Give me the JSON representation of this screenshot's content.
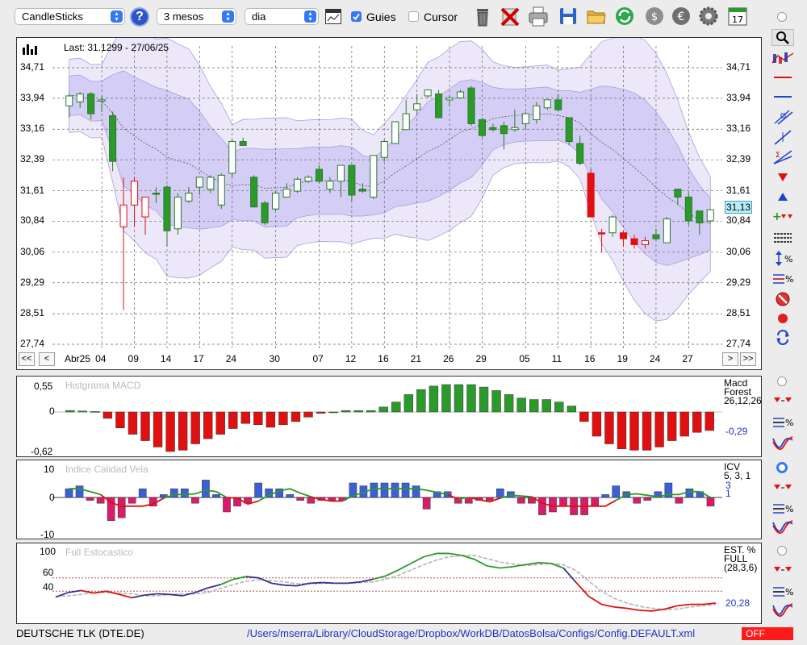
{
  "toolbar": {
    "chart_type": "CandleSticks",
    "period": "3 mesos",
    "interval": "dia",
    "guides_label": "Guies",
    "guides_checked": true,
    "cursor_label": "Cursor",
    "cursor_checked": false,
    "help": "?",
    "calendar_day": "17"
  },
  "main": {
    "last_label": "Last: 31.1299 - 27/06/25",
    "y_ticks": [
      "34,71",
      "33,94",
      "33,16",
      "32,39",
      "31,61",
      "30,84",
      "30,06",
      "29,29",
      "28,51",
      "27,74"
    ],
    "current_value": "31,13",
    "x_month": "Abr25",
    "x_ticks": [
      "04",
      "09",
      "14",
      "17",
      "24",
      "30",
      "07",
      "12",
      "16",
      "21",
      "26",
      "29",
      "05",
      "11",
      "16",
      "19",
      "24",
      "27"
    ],
    "nav": {
      "first": "<<",
      "prev": "<",
      "next": ">",
      "last": ">>"
    }
  },
  "macd": {
    "title": "Histgrama MACD",
    "y_ticks": [
      "0,55",
      "0",
      "-0,62"
    ],
    "name1": "Macd",
    "name2": "Forest",
    "params": "26,12,26",
    "value": "-0,29"
  },
  "icv": {
    "title": "Indice Calidad Vela",
    "y_ticks": [
      "10",
      "0",
      "-10"
    ],
    "name": "ICV",
    "params": "5, 3, 1",
    "value1": "3",
    "value2": "1"
  },
  "stoch": {
    "title": "Full Estocastico",
    "y_ticks": [
      "100",
      "60",
      "40",
      "0"
    ],
    "name1": "EST. %",
    "name2": "FULL",
    "params": "(28,3,6)",
    "value": "20,28"
  },
  "status": {
    "ticker": "DEUTSCHE TLK (DTE.DE)",
    "path": "/Users/mserra/Library/CloudStorage/Dropbox/WorkDB/DatosBolsa/Configs/Config.DEFAULT.xml",
    "state": "OFF"
  },
  "chart_data": {
    "type": "candlestick",
    "price_range": [
      27.74,
      34.71
    ],
    "up_color": "#ffffff",
    "down_color": "#2b9a2b",
    "falling_color": "#e01010",
    "candles": [
      {
        "o": 33.75,
        "h": 34.05,
        "l": 33.45,
        "c": 34.0,
        "up": true
      },
      {
        "o": 33.85,
        "h": 34.1,
        "l": 33.7,
        "c": 34.05,
        "up": true
      },
      {
        "o": 34.05,
        "h": 34.1,
        "l": 33.4,
        "c": 33.55,
        "up": false
      },
      {
        "o": 33.9,
        "h": 34.0,
        "l": 33.6,
        "c": 33.9,
        "up": true
      },
      {
        "o": 33.5,
        "h": 33.6,
        "l": 32.1,
        "c": 32.35,
        "up": false
      },
      {
        "o": 30.7,
        "h": 31.95,
        "l": 28.6,
        "c": 31.25,
        "up": true,
        "red": true
      },
      {
        "o": 31.25,
        "h": 31.95,
        "l": 30.7,
        "c": 31.85,
        "up": true,
        "red": true
      },
      {
        "o": 30.95,
        "h": 31.45,
        "l": 30.5,
        "c": 31.45,
        "up": true,
        "red": true
      },
      {
        "o": 31.55,
        "h": 31.7,
        "l": 31.3,
        "c": 31.55,
        "up": false
      },
      {
        "o": 31.7,
        "h": 31.75,
        "l": 30.2,
        "c": 30.6,
        "up": false
      },
      {
        "o": 30.65,
        "h": 31.55,
        "l": 30.5,
        "c": 31.45,
        "up": true
      },
      {
        "o": 31.35,
        "h": 31.7,
        "l": 31.3,
        "c": 31.55,
        "up": true
      },
      {
        "o": 31.7,
        "h": 31.95,
        "l": 31.5,
        "c": 31.95,
        "up": true
      },
      {
        "o": 31.65,
        "h": 32.0,
        "l": 31.55,
        "c": 31.95,
        "up": true
      },
      {
        "o": 31.25,
        "h": 32.05,
        "l": 31.15,
        "c": 32.0,
        "up": true
      },
      {
        "o": 32.05,
        "h": 32.9,
        "l": 31.95,
        "c": 32.85,
        "up": true
      },
      {
        "o": 32.85,
        "h": 32.95,
        "l": 32.75,
        "c": 32.75,
        "up": false
      },
      {
        "o": 31.95,
        "h": 32.0,
        "l": 31.2,
        "c": 31.2,
        "up": false
      },
      {
        "o": 31.3,
        "h": 31.35,
        "l": 30.75,
        "c": 30.8,
        "up": false
      },
      {
        "o": 31.15,
        "h": 31.6,
        "l": 31.1,
        "c": 31.55,
        "up": true
      },
      {
        "o": 31.45,
        "h": 31.8,
        "l": 31.45,
        "c": 31.65,
        "up": true
      },
      {
        "o": 31.6,
        "h": 31.95,
        "l": 31.55,
        "c": 31.9,
        "up": true
      },
      {
        "o": 31.85,
        "h": 32.0,
        "l": 31.8,
        "c": 31.95,
        "up": true
      },
      {
        "o": 32.15,
        "h": 32.25,
        "l": 31.8,
        "c": 31.85,
        "up": false
      },
      {
        "o": 31.65,
        "h": 31.95,
        "l": 31.55,
        "c": 31.85,
        "up": true
      },
      {
        "o": 31.85,
        "h": 32.25,
        "l": 31.45,
        "c": 32.25,
        "up": true
      },
      {
        "o": 32.25,
        "h": 32.25,
        "l": 31.35,
        "c": 31.5,
        "up": false
      },
      {
        "o": 31.65,
        "h": 31.8,
        "l": 31.55,
        "c": 31.6,
        "up": false
      },
      {
        "o": 31.45,
        "h": 32.5,
        "l": 31.4,
        "c": 32.5,
        "up": true
      },
      {
        "o": 32.45,
        "h": 32.9,
        "l": 32.35,
        "c": 32.85,
        "up": true
      },
      {
        "o": 32.8,
        "h": 33.35,
        "l": 32.8,
        "c": 33.35,
        "up": true
      },
      {
        "o": 33.15,
        "h": 33.9,
        "l": 33.15,
        "c": 33.55,
        "up": true
      },
      {
        "o": 33.65,
        "h": 34.05,
        "l": 33.55,
        "c": 33.8,
        "up": true
      },
      {
        "o": 34.0,
        "h": 34.15,
        "l": 33.95,
        "c": 34.15,
        "up": true
      },
      {
        "o": 34.05,
        "h": 34.15,
        "l": 33.45,
        "c": 33.45,
        "up": false
      },
      {
        "o": 33.9,
        "h": 34.0,
        "l": 33.75,
        "c": 33.95,
        "up": true
      },
      {
        "o": 33.95,
        "h": 34.15,
        "l": 33.95,
        "c": 34.1,
        "up": true
      },
      {
        "o": 34.2,
        "h": 34.25,
        "l": 33.25,
        "c": 33.3,
        "up": false
      },
      {
        "o": 33.4,
        "h": 33.45,
        "l": 32.95,
        "c": 33.0,
        "up": false
      },
      {
        "o": 33.2,
        "h": 33.3,
        "l": 33.1,
        "c": 33.15,
        "up": false
      },
      {
        "o": 33.25,
        "h": 33.35,
        "l": 32.65,
        "c": 33.05,
        "up": false
      },
      {
        "o": 33.15,
        "h": 33.65,
        "l": 33.1,
        "c": 33.2,
        "up": true
      },
      {
        "o": 33.3,
        "h": 33.6,
        "l": 33.15,
        "c": 33.55,
        "up": true
      },
      {
        "o": 33.4,
        "h": 33.85,
        "l": 33.3,
        "c": 33.75,
        "up": true
      },
      {
        "o": 33.7,
        "h": 33.9,
        "l": 33.65,
        "c": 33.9,
        "up": true
      },
      {
        "o": 33.9,
        "h": 34.05,
        "l": 33.6,
        "c": 33.65,
        "up": false
      },
      {
        "o": 33.45,
        "h": 33.45,
        "l": 32.75,
        "c": 32.85,
        "up": false
      },
      {
        "o": 32.8,
        "h": 33.0,
        "l": 32.25,
        "c": 32.3,
        "up": false
      },
      {
        "o": 32.05,
        "h": 32.15,
        "l": 30.95,
        "c": 30.95,
        "up": false,
        "red": true
      },
      {
        "o": 30.55,
        "h": 30.65,
        "l": 30.05,
        "c": 30.55,
        "up": false,
        "red": true
      },
      {
        "o": 30.55,
        "h": 31.0,
        "l": 30.45,
        "c": 30.95,
        "up": true
      },
      {
        "o": 30.55,
        "h": 30.6,
        "l": 30.2,
        "c": 30.4,
        "up": false,
        "red": true
      },
      {
        "o": 30.4,
        "h": 30.5,
        "l": 30.15,
        "c": 30.25,
        "up": false,
        "red": true
      },
      {
        "o": 30.25,
        "h": 30.45,
        "l": 30.15,
        "c": 30.35,
        "up": true,
        "red": true
      },
      {
        "o": 30.4,
        "h": 30.65,
        "l": 30.35,
        "c": 30.5,
        "up": false
      },
      {
        "o": 30.3,
        "h": 30.95,
        "l": 30.3,
        "c": 30.9,
        "up": true
      },
      {
        "o": 31.45,
        "h": 31.55,
        "l": 31.25,
        "c": 31.65,
        "up": false
      },
      {
        "o": 31.45,
        "h": 31.55,
        "l": 30.75,
        "c": 30.85,
        "up": false
      },
      {
        "o": 31.1,
        "h": 31.1,
        "l": 30.5,
        "c": 30.8,
        "up": false
      },
      {
        "o": 30.85,
        "h": 31.15,
        "l": 30.8,
        "c": 31.13,
        "up": true
      }
    ],
    "macd_hist": [
      0.03,
      0.02,
      0.01,
      -0.1,
      -0.25,
      -0.35,
      -0.45,
      -0.55,
      -0.62,
      -0.6,
      -0.5,
      -0.42,
      -0.35,
      -0.26,
      -0.18,
      -0.2,
      -0.24,
      -0.2,
      -0.15,
      -0.08,
      -0.02,
      0.0,
      0.03,
      0.03,
      0.03,
      0.1,
      0.2,
      0.35,
      0.45,
      0.52,
      0.55,
      0.55,
      0.55,
      0.5,
      0.43,
      0.35,
      0.28,
      0.25,
      0.25,
      0.2,
      0.12,
      -0.15,
      -0.38,
      -0.5,
      -0.58,
      -0.6,
      -0.6,
      -0.55,
      -0.45,
      -0.38,
      -0.32,
      -0.29
    ],
    "icv": [
      3,
      4,
      -1,
      -2,
      -8,
      -7,
      -2,
      3,
      -3,
      1,
      3,
      3,
      -2,
      6,
      1,
      -5,
      -3,
      -2,
      5,
      3,
      3,
      1,
      -1,
      -2,
      -1,
      -1,
      -1,
      5,
      4,
      5,
      5,
      5,
      5,
      4,
      -4,
      2,
      2,
      -2,
      -2,
      -1,
      -1,
      3,
      2,
      -2,
      -2,
      -6,
      -5,
      -3,
      -6,
      -6,
      -3,
      1,
      4,
      2,
      -2,
      -1,
      2,
      5,
      -2,
      3,
      2,
      -3
    ],
    "stoch_k": [
      31,
      38,
      41,
      37,
      40,
      35,
      30,
      34,
      36,
      35,
      33,
      38,
      45,
      50,
      58,
      62,
      60,
      52,
      49,
      48,
      52,
      53,
      52,
      52,
      54,
      58,
      63,
      72,
      82,
      92,
      97,
      97,
      94,
      88,
      78,
      75,
      77,
      80,
      83,
      82,
      75,
      53,
      32,
      20,
      16,
      14,
      11,
      10,
      13,
      18,
      20,
      20,
      22
    ],
    "stoch_d": [
      32,
      33,
      35,
      38,
      38,
      37,
      36,
      33,
      33,
      35,
      36,
      36,
      38,
      44,
      50,
      55,
      57,
      56,
      54,
      51,
      51,
      52,
      52,
      52,
      53,
      54,
      58,
      64,
      72,
      80,
      87,
      92,
      94,
      94,
      89,
      84,
      81,
      79,
      80,
      82,
      80,
      71,
      55,
      40,
      29,
      22,
      17,
      14,
      12,
      13,
      16,
      18,
      20
    ]
  }
}
